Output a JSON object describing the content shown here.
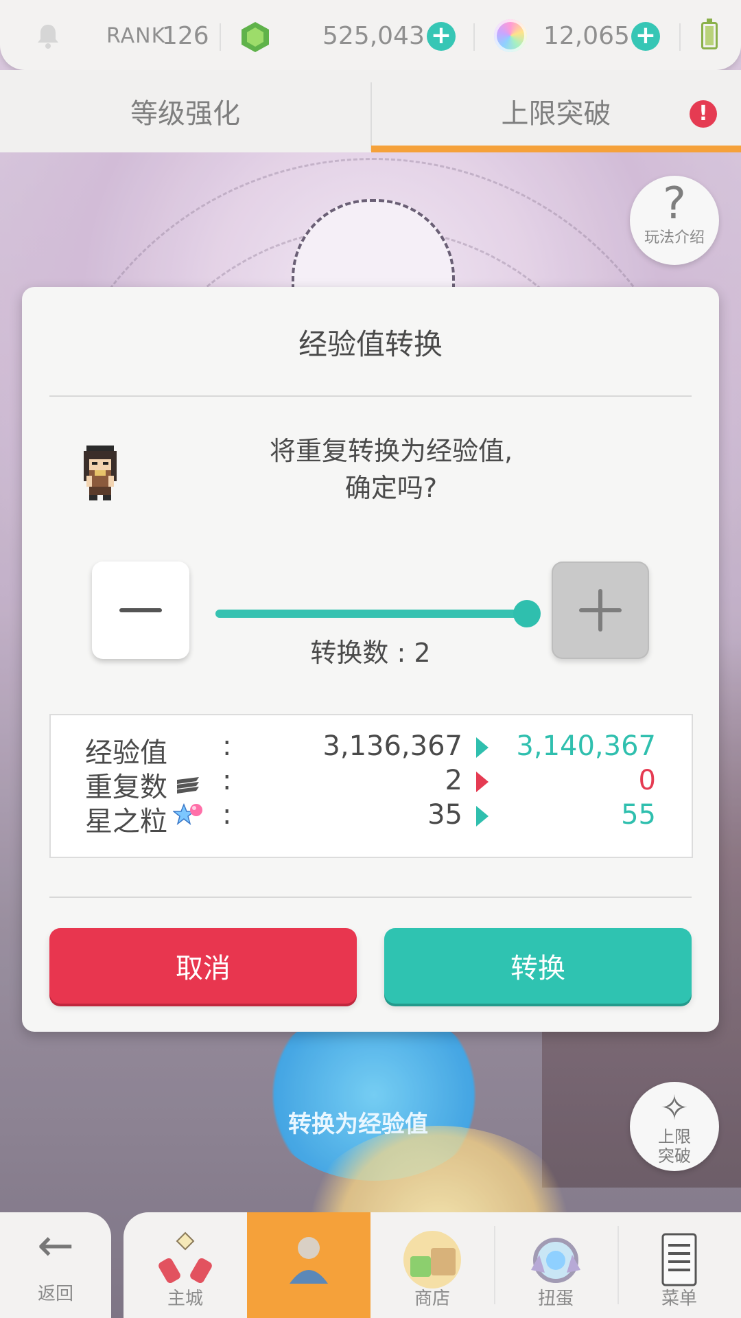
{
  "status_bar": {
    "rank_label": "RANK",
    "rank_value": "126",
    "gems": "525,043",
    "orbs": "12,065",
    "icons": [
      "bell-icon",
      "gem-icon",
      "add-gems-icon",
      "orb-icon",
      "add-orbs-icon",
      "battery-icon"
    ]
  },
  "tabs": [
    {
      "label": "等级强化"
    },
    {
      "label": "上限突破",
      "badge": "!"
    }
  ],
  "side_buttons": {
    "help_label": "玩法介绍",
    "help_glyph": "?",
    "limit_break_label_line1": "上限",
    "limit_break_label_line2": "突破"
  },
  "background": {
    "convert_text": "转换为经验值"
  },
  "dialog": {
    "title": "经验值转换",
    "message_line1": "将重复转换为经验值,",
    "message_line2": "确定吗?",
    "count_text": "转换数 : 2",
    "stepper_fill": 1.0,
    "stats": [
      {
        "label": "经验值",
        "icon": "",
        "before": "3,136,367",
        "after": "3,140,367",
        "arrow_color": "#2fbfae",
        "after_color": "#2fbfae"
      },
      {
        "label": "重复数",
        "icon": "stack-icon",
        "before": "2",
        "after": "0",
        "arrow_color": "#e53b52",
        "after_color": "#e53b52"
      },
      {
        "label": "星之粒",
        "icon": "star-grain-icon",
        "before": "35",
        "after": "55",
        "arrow_color": "#2fbfae",
        "after_color": "#2fbfae"
      }
    ],
    "colon": ":",
    "cancel_label": "取消",
    "confirm_label": "转换"
  },
  "bottom_nav": {
    "back_label": "返回",
    "items": [
      {
        "label": "主城",
        "icon": "castle-icon",
        "active": false
      },
      {
        "label": "",
        "icon": "character-icon",
        "active": true
      },
      {
        "label": "商店",
        "icon": "shop-icon",
        "active": false
      },
      {
        "label": "扭蛋",
        "icon": "gacha-icon",
        "active": false
      },
      {
        "label": "菜单",
        "icon": "menu-icon",
        "active": false
      }
    ]
  },
  "colors": {
    "accent_teal": "#2fbfae",
    "accent_red": "#e53b52",
    "accent_orange": "#f5a13a"
  }
}
